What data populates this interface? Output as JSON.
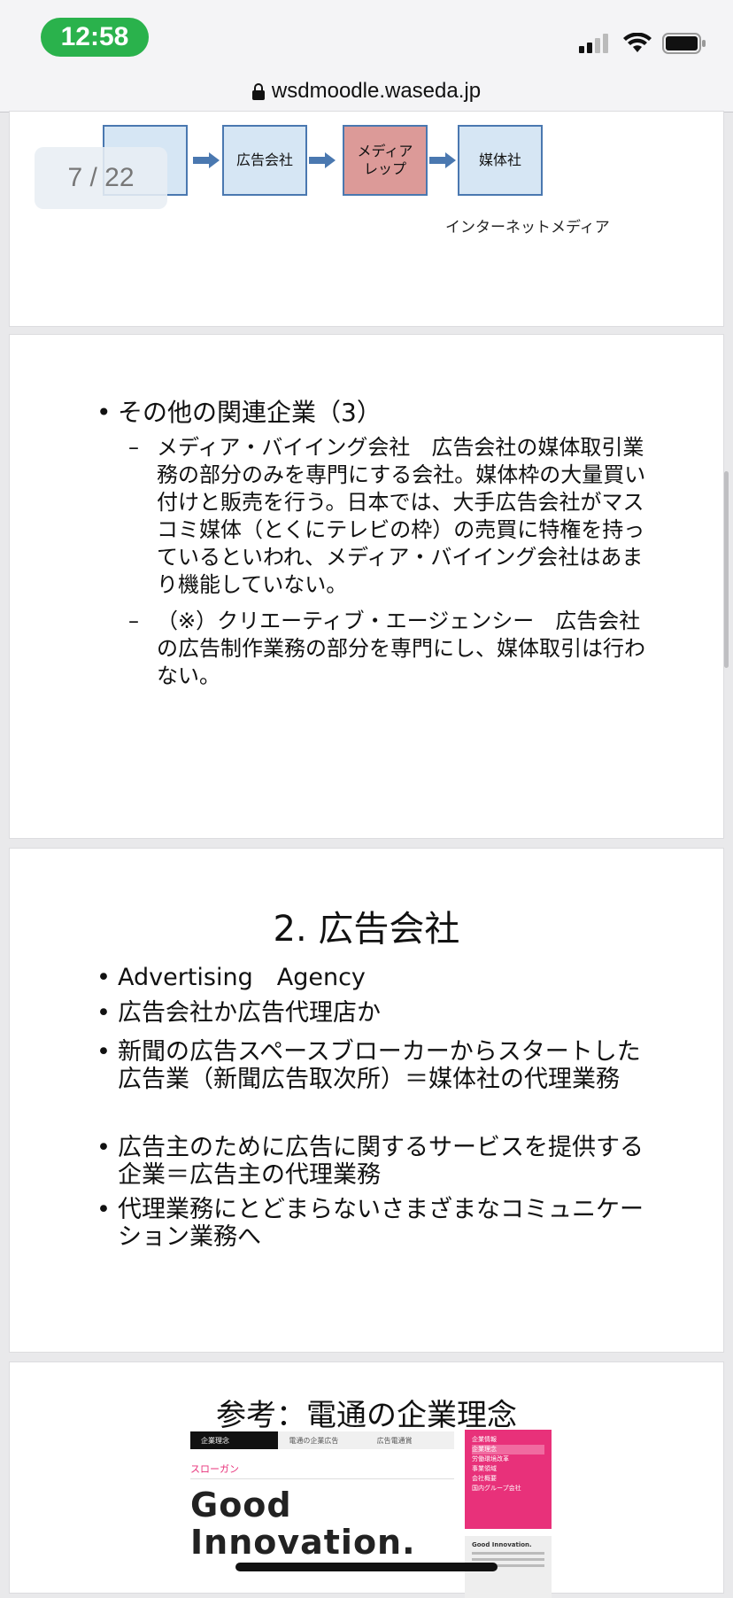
{
  "status_bar": {
    "time": "12:58",
    "signal_icon": "cellular-signal-icon",
    "wifi_icon": "wifi-icon",
    "battery_icon": "battery-icon"
  },
  "url_bar": {
    "lock_icon": "lock-icon",
    "url": "wsdmoodle.waseda.jp"
  },
  "pager": {
    "text": "7 / 22"
  },
  "slide1": {
    "boxes": [
      "広告会社",
      "メディア\nレップ",
      "媒体社"
    ],
    "caption": "インターネットメディア"
  },
  "slide2": {
    "heading": "その他の関連企業（3）",
    "items": [
      "メディア・バイイング会社　広告会社の媒体取引業務の部分のみを専門にする会社。媒体枠の大量買い付けと販売を行う。日本では、大手広告会社がマスコミ媒体（とくにテレビの枠）の売買に特権を持っているといわれ、メディア・バイイング会社はあまり機能していない。",
      "（※）クリエーティブ・エージェンシー　広告会社の広告制作業務の部分を専門にし、媒体取引は行わない。"
    ]
  },
  "slide3": {
    "title": "2. 広告会社",
    "bullets": [
      "Advertising　Agency",
      "広告会社か広告代理店か",
      "新聞の広告スペースブローカーからスタートした広告業（新聞広告取次所）＝媒体社の代理業務",
      "広告主のために広告に関するサービスを提供する企業＝広告主の代理業務",
      "代理業務にとどまらないさまざまなコミュニケーション業務へ"
    ]
  },
  "slide4": {
    "title": "参考：電通の企業理念",
    "nav": [
      "企業理念",
      "電通の企業広告",
      "広告電通賞"
    ],
    "slogan_label": "スローガン",
    "slogan": "Good\nInnovation.",
    "side_menu": [
      "企業情報",
      "企業理念",
      "労働環境改革",
      "事業領域",
      "会社概要",
      "国内グループ会社"
    ],
    "side_card_title": "Good Innovation."
  },
  "colors": {
    "status_pill": "#2ab24c",
    "box_fill": "#d6e6f4",
    "rep_fill": "#dc9a98",
    "accent_pink": "#e8317a"
  }
}
